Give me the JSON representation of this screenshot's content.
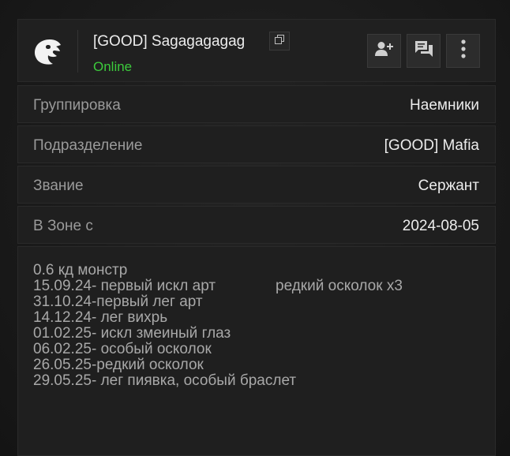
{
  "profile": {
    "name": "[GOOD] Sagagagagag",
    "status": "Online",
    "logo_icon": "eagle-head-icon",
    "copy_icon": "copy-icon",
    "actions": {
      "add_friend_icon": "add-friend-icon",
      "message_icon": "chat-icon",
      "more_icon": "more-vertical-icon"
    },
    "status_color": "#3ccb3c"
  },
  "details": [
    {
      "label": "Группировка",
      "value": "Наемники"
    },
    {
      "label": "Подразделение",
      "value": "[GOOD] Mafia"
    },
    {
      "label": "Звание",
      "value": "Сержант"
    },
    {
      "label": "В Зоне с",
      "value": "2024-08-05"
    }
  ],
  "notes": {
    "lines": [
      "0.6 кд монстр",
      "15.09.24- первый искл арт",
      "31.10.24-первый лег арт",
      "14.12.24- лег вихрь",
      "01.02.25- искл змеиный глаз",
      "06.02.25- особый осколок",
      "26.05.25-редкий осколок",
      "29.05.25- лег пиявка, особый браслет"
    ],
    "line_2_extra": "редкий осколок x3"
  }
}
